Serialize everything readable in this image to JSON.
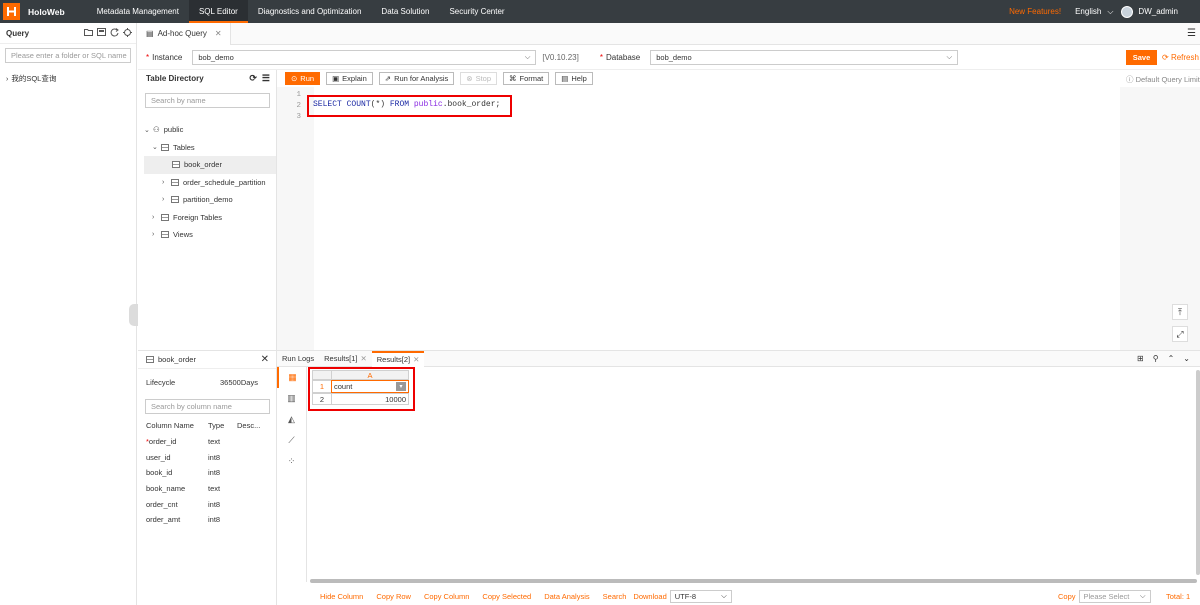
{
  "topbar": {
    "brand": "HoloWeb",
    "nav": [
      "Metadata Management",
      "SQL Editor",
      "Diagnostics and Optimization",
      "Data Solution",
      "Security Center"
    ],
    "new_features": "New Features!",
    "language": "English",
    "user": "DW_admin"
  },
  "left_panel": {
    "title": "Query",
    "search_placeholder": "Please enter a folder or SQL name",
    "tree_item": "我的SQL查询"
  },
  "tabs": [
    {
      "label": "Ad-hoc Query"
    }
  ],
  "instance_bar": {
    "instance_label": "Instance",
    "instance_value": "bob_demo",
    "version": "[V0.10.23]",
    "database_label": "Database",
    "database_value": "bob_demo",
    "save_label": "Save",
    "refresh_label": "Refresh"
  },
  "table_directory": {
    "title": "Table Directory",
    "search_placeholder": "Search by name",
    "schema": "public",
    "tables_label": "Tables",
    "tables": [
      "book_order",
      "order_schedule_partition",
      "partition_demo"
    ],
    "foreign_tables_label": "Foreign Tables",
    "views_label": "Views"
  },
  "toolbar": {
    "run": "Run",
    "explain": "Explain",
    "run_for_analysis": "Run for Analysis",
    "stop": "Stop",
    "format": "Format",
    "help": "Help",
    "default_query_limit": "Default Query Limit"
  },
  "editor": {
    "line_numbers": [
      "1",
      "2",
      "3"
    ],
    "kw1": "SELECT",
    "fn": "COUNT",
    "arg": "(*)",
    "kw2": "FROM",
    "schema": "public",
    "rest": ".book_order;"
  },
  "column_panel": {
    "table_name": "book_order",
    "lifecycle_label": "Lifecycle",
    "lifecycle_value": "36500Days",
    "search_placeholder": "Search by column name",
    "headers": [
      "Column Name",
      "Type",
      "Desc..."
    ],
    "columns": [
      {
        "name": "order_id",
        "type": "text",
        "required": "*"
      },
      {
        "name": "user_id",
        "type": "int8"
      },
      {
        "name": "book_id",
        "type": "int8"
      },
      {
        "name": "book_name",
        "type": "text"
      },
      {
        "name": "order_cnt",
        "type": "int8"
      },
      {
        "name": "order_amt",
        "type": "int8"
      }
    ]
  },
  "results": {
    "tabs": [
      "Run Logs",
      "Results[1]",
      "Results[2]"
    ],
    "grid": {
      "col_header": "A",
      "row_numbers": [
        "1",
        "2"
      ],
      "header_cell": "count",
      "value_cell": "10000"
    },
    "bottom_actions": [
      "Hide Column",
      "Copy Row",
      "Copy Column",
      "Copy Selected",
      "Data Analysis",
      "Search"
    ],
    "download_label": "Download",
    "encoding": "UTF-8",
    "copy_label": "Copy",
    "copy_placeholder": "Please Select",
    "total": "Total: 1"
  },
  "colors": {
    "accent": "#ff6a00",
    "topbar": "#373d41",
    "highlight": "#e00000"
  },
  "icons": [
    "logo-icon",
    "folder-icon",
    "save-query-icon",
    "refresh-icon",
    "locate-icon",
    "menu-icon",
    "table-icon",
    "schema-icon",
    "grid-icon",
    "bar-chart-icon",
    "area-chart-icon",
    "line-chart-icon",
    "scatter-icon"
  ]
}
